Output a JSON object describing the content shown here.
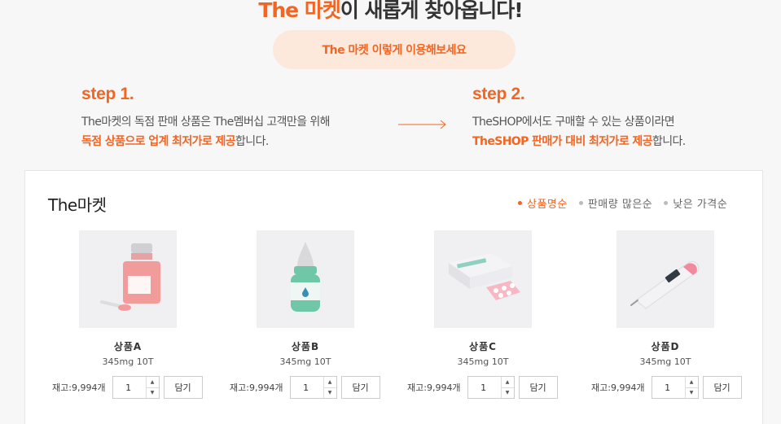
{
  "hero": {
    "title_accent": "The 마켓",
    "title_rest": "이 새롭게 찾아옵니다!"
  },
  "guide_button": "The 마켓 이렇게 이용해보세요",
  "step1": {
    "label": "step 1.",
    "line1": "The마켓의 독점 판매 상품은 The멤버십 고객만을 위해",
    "line2_hl": "독점 상품으로 업계 최저가로 제공",
    "line2_rest": "합니다."
  },
  "step2": {
    "label": "step 2.",
    "line1": "TheSHOP에서도 구매할 수 있는 상품이라면",
    "line2_hl": "TheSHOP 판매가 대비 최저가로 제공",
    "line2_rest": "합니다."
  },
  "section": {
    "title": "The마켓"
  },
  "sort": [
    "상품명순",
    "판매량 많은순",
    "낮은 가격순"
  ],
  "products": [
    {
      "name": "상품A",
      "spec": "345mg 10T",
      "stock": "재고:9,994개",
      "qty": "1",
      "cart": "담기",
      "icon": "syrup-bottle-icon"
    },
    {
      "name": "상품B",
      "spec": "345mg 10T",
      "stock": "재고:9,994개",
      "qty": "1",
      "cart": "담기",
      "icon": "dropper-bottle-icon"
    },
    {
      "name": "상품C",
      "spec": "345mg 10T",
      "stock": "재고:9,994개",
      "qty": "1",
      "cart": "담기",
      "icon": "pill-box-icon"
    },
    {
      "name": "상품D",
      "spec": "345mg 10T",
      "stock": "재고:9,994개",
      "qty": "1",
      "cart": "담기",
      "icon": "thermometer-icon"
    }
  ],
  "colors": {
    "accent": "#f26522",
    "pill_bg": "#fde9dc"
  }
}
